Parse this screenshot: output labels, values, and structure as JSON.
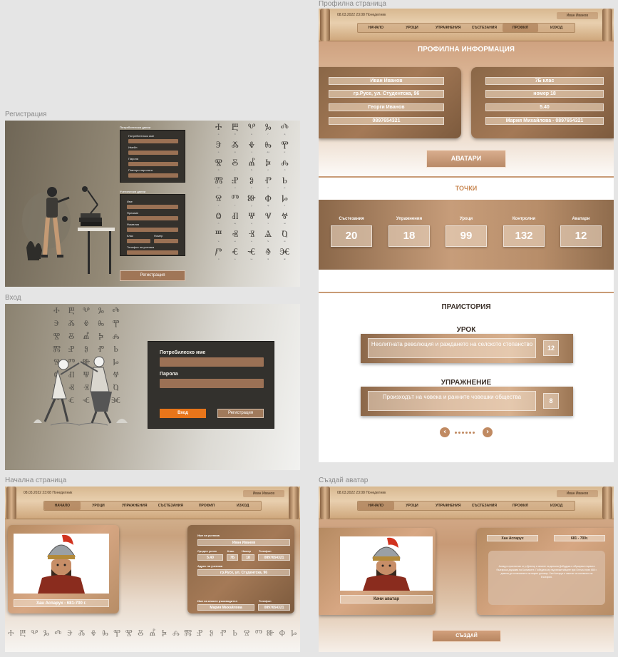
{
  "frames": {
    "profile": "Профилна страница",
    "registration": "Регистрация",
    "login": "Вход",
    "home": "Начална страница",
    "create_avatar": "Създай аватар"
  },
  "header": {
    "date": "08.03.2022 23:08 Понеделник",
    "user": "Иван Иванов",
    "nav": [
      "НАЧАЛО",
      "УРОЦИ",
      "УПРАЖНЕНИЯ",
      "СЪСТЕЗАНИЯ",
      "ПРОФИЛ",
      "ИЗХОД"
    ]
  },
  "registration": {
    "user_data_title": "Потребителски данни",
    "username_label": "Потребителско име",
    "email_label": "Имейл",
    "password_label": "Парола",
    "repeat_password_label": "Повтори паролата",
    "student_data_title": "Ученически данни",
    "first_name_label": "Име",
    "middle_name_label": "Презиме",
    "last_name_label": "Фамилия",
    "class_label": "Клас",
    "number_label": "Номер",
    "phone_label": "Телефон на ученика",
    "submit_label": "Регистрация"
  },
  "login": {
    "username_label": "Потребилеско име",
    "password_label": "Парола",
    "login_button": "Вход",
    "register_button": "Регистрация"
  },
  "glyphs": {
    "reg_rows": [
      [
        "Ⰰ",
        "Ⰱ",
        "Ⰲ",
        "Ⰳ",
        "Ⰴ"
      ],
      [
        "Ⰵ",
        "Ⰶ",
        "Ⰷ",
        "Ⰸ",
        "Ⰹ"
      ],
      [
        "Ⰺ",
        "Ⰻ",
        "Ⰼ",
        "Ⰽ",
        "Ⰾ"
      ],
      [
        "Ⰿ",
        "Ⱀ",
        "Ⱁ",
        "Ⱂ",
        "Ⱃ"
      ],
      [
        "Ⱄ",
        "Ⱅ",
        "Ⱆ",
        "Ⱇ",
        "Ⱈ"
      ],
      [
        "Ⱉ",
        "Ⱊ",
        "Ⱋ",
        "Ⱌ",
        "Ⱍ"
      ],
      [
        "Ⱎ",
        "Ⱏ",
        "Ⱐ",
        "Ⱑ",
        "Ⱒ"
      ],
      [
        "Ⱓ",
        "Ⱔ",
        "Ⱕ",
        "Ⱖ",
        "Ⱗ"
      ]
    ],
    "reg_subs": [
      [
        "а",
        "б",
        "в",
        "г",
        "д"
      ],
      [
        "е",
        "ж",
        "з",
        "дз",
        "и"
      ],
      [
        "й",
        "і",
        "ђ",
        "к",
        "л"
      ],
      [
        "м",
        "н",
        "о",
        "п",
        "р"
      ],
      [
        "с",
        "т",
        "у",
        "ф",
        "х"
      ],
      [
        "о",
        "щ",
        "ц",
        "ч",
        "ш"
      ],
      [
        "ъ",
        "ы",
        "ь",
        "ѣ",
        "ю"
      ],
      [
        "я",
        "ѧ",
        "ѩ",
        "ѫ",
        "ѭ"
      ]
    ],
    "login_rows": [
      [
        "Ⰰ",
        "Ⰱ",
        "Ⰲ",
        "Ⰳ",
        "Ⰴ"
      ],
      [
        "Ⰵ",
        "Ⰶ",
        "Ⰷ",
        "Ⰸ",
        "Ⰹ"
      ],
      [
        "Ⰺ",
        "Ⰻ",
        "Ⰼ",
        "Ⰽ",
        "Ⰾ"
      ],
      [
        "Ⰿ",
        "Ⱀ",
        "Ⱁ",
        "Ⱂ",
        "Ⱃ"
      ],
      [
        "Ⱄ",
        "Ⱅ",
        "Ⱆ",
        "Ⱇ",
        "Ⱈ"
      ],
      [
        "Ⱉ",
        "Ⱊ",
        "Ⱋ",
        "Ⱌ",
        "Ⱍ"
      ],
      [
        "Ⱎ",
        "Ⱏ",
        "Ⱐ",
        "Ⱑ",
        "Ⱒ"
      ],
      [
        "Ⱓ",
        "Ⱔ",
        "Ⱕ",
        "Ⱖ",
        "Ⱗ"
      ]
    ],
    "home_strip": [
      "Ⰰ",
      "Ⰱ",
      "Ⰲ",
      "Ⰳ",
      "Ⰴ",
      "Ⰵ",
      "Ⰶ",
      "Ⰷ",
      "Ⰸ",
      "Ⰹ",
      "Ⰺ",
      "Ⰻ",
      "Ⰼ",
      "Ⰽ",
      "Ⰾ",
      "Ⰿ",
      "Ⱀ",
      "Ⱁ",
      "Ⱂ",
      "Ⱃ",
      "Ⱄ",
      "Ⱅ",
      "Ⱆ",
      "Ⱇ",
      "Ⱈ"
    ]
  },
  "home": {
    "portrait_caption": "Хан Аспарух - 681-700 г.",
    "student_name_label": "Име на ученика",
    "student_name": "Иван Иванов",
    "avg_grade_label": "Среден успех",
    "class_label": "Клас",
    "number_label": "Номер",
    "phone_label": "Телефон",
    "avg_grade": "5.40",
    "class_value": "7Б",
    "number_value": "18",
    "phone_value": "0897654321",
    "address_label": "Адрес на ученика",
    "address": "гр.Русе, ул. Студентска, 96",
    "teacher_label": "Име на класен ръководител",
    "teacher_phone_label": "Телефон",
    "teacher_name": "Мария Михайлова",
    "teacher_phone": "0897654321"
  },
  "profile": {
    "info_title": "ПРОФИЛНА ИНФОРМАЦИЯ",
    "left_pills": [
      "Иван Иванов",
      "гр.Русе, ул. Студентска, 96",
      "Георги Иванов",
      "0897654321"
    ],
    "right_pills": [
      "7Б клас",
      "номер 18",
      "5.40",
      "Мария Михайлова - 0897654321"
    ],
    "avatars_button": "АВАТАРИ",
    "points_title": "ТОЧКИ",
    "stats": [
      {
        "label": "Състезания",
        "value": "20"
      },
      {
        "label": "Упражнения",
        "value": "18"
      },
      {
        "label": "Уроци",
        "value": "99"
      },
      {
        "label": "Контролни",
        "value": "132"
      },
      {
        "label": "Аватари",
        "value": "12"
      }
    ],
    "era_title": "ПРАИСТОРИЯ",
    "lesson_title": "УРОК",
    "lesson_text": "Неолитната революция и раждането на селското стопанство",
    "lesson_num": "12",
    "exercise_title": "УПРАЖНЕНИЕ",
    "exercise_text": "Произходът на човека и ранните човешки общества",
    "exercise_num": "8"
  },
  "create_avatar": {
    "name_pill": "Хан Аспарух",
    "years_pill": "681 - 700г.",
    "upload_label": "Качи аватар",
    "description": "Аспарух пристигнал от р.Днепър в земите на днешна Добруджа и образувал първата българска държава на Балканите. Победата му над византийците при Онгъла през 680 г. довела до сключването на мирен договор. Хан Аспарух е смятан за основател на България.",
    "create_button": "СЪЗДАЙ"
  },
  "colors": {
    "accent_orange": "#e8751a",
    "brown": "#a07657",
    "dark_panel": "#34312c"
  }
}
